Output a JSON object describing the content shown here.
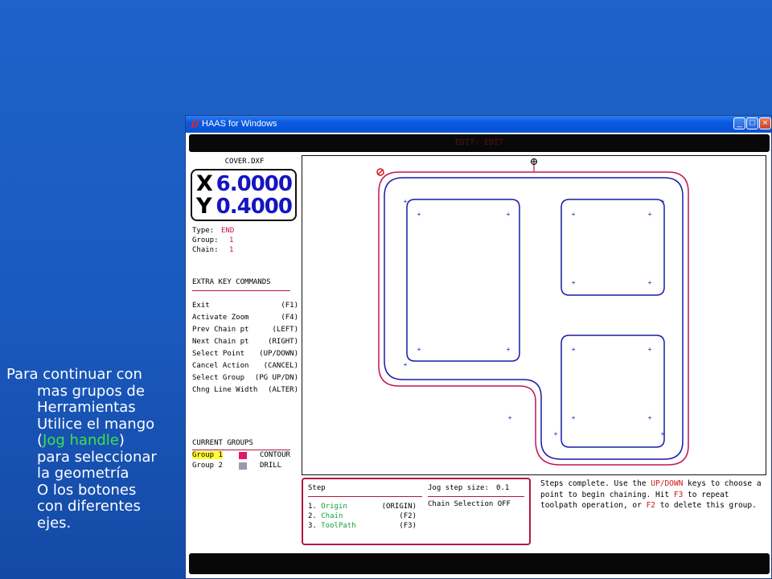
{
  "slide": {
    "lines": [
      "Para continuar con",
      "mas grupos de",
      "Herramientas",
      "Utilice el mango",
      "(",
      "Jog handle",
      ")",
      "para seleccionar",
      "la geometría",
      "O los botones",
      "con diferentes",
      "ejes."
    ]
  },
  "window": {
    "title": "HAAS for Windows",
    "buttons": {
      "minimize": "_",
      "maximize": "□",
      "close": "×"
    },
    "top_status": "EDIT: EDIT"
  },
  "left_panel": {
    "filename": "COVER.DXF",
    "dro": {
      "x_label": "X",
      "x_value": "6.0000",
      "y_label": "Y",
      "y_value": "0.4000"
    },
    "info": {
      "type_label": "Type:",
      "type_value": "END",
      "group_label": "Group:",
      "group_value": "1",
      "chain_label": "Chain:",
      "chain_value": "1"
    },
    "extra_heading": "EXTRA KEY COMMANDS",
    "commands": [
      {
        "label": "Exit",
        "key": "(F1)"
      },
      {
        "label": "Activate Zoom",
        "key": "(F4)"
      },
      {
        "label": "Prev Chain pt",
        "key": "(LEFT)"
      },
      {
        "label": "Next Chain pt",
        "key": "(RIGHT)"
      },
      {
        "label": "Select Point",
        "key": "(UP/DOWN)"
      },
      {
        "label": "Cancel Action",
        "key": "(CANCEL)"
      },
      {
        "label": "Select Group",
        "key": "(PG UP/DN)"
      },
      {
        "label": "Chng Line Width",
        "key": "(ALTER)"
      }
    ],
    "groups_heading": "CURRENT GROUPS",
    "groups": [
      {
        "name": "Group 1",
        "type": "CONTOUR",
        "color": "#e0186a"
      },
      {
        "name": "Group 2",
        "type": "DRILL",
        "color": "#9a9aae"
      }
    ]
  },
  "step_panel": {
    "heading": "Step",
    "jog_label": "Jog step size:",
    "jog_value": "0.1",
    "chain_selection": "Chain Selection OFF",
    "steps": [
      {
        "num": "1.",
        "name": "Origin",
        "key": "(ORIGIN)"
      },
      {
        "num": "2.",
        "name": "Chain",
        "key": "(F2)"
      },
      {
        "num": "3.",
        "name": "ToolPath",
        "key": "(F3)"
      }
    ]
  },
  "message": {
    "p1": "Steps complete. Use the ",
    "k1": "UP/DOWN",
    "p2": " keys to choose a point to begin chaining. Hit ",
    "k2": "F3",
    "p3": " to repeat toolpath operation, or ",
    "k3": "F2",
    "p4": " to delete this group."
  },
  "colors": {
    "accent_red": "#b3183e",
    "path_blue": "#1a1aa8",
    "path_red": "#c0145a",
    "dro_blue": "#1515c0",
    "step_green": "#14a03c",
    "highlight": "#ffff33"
  }
}
